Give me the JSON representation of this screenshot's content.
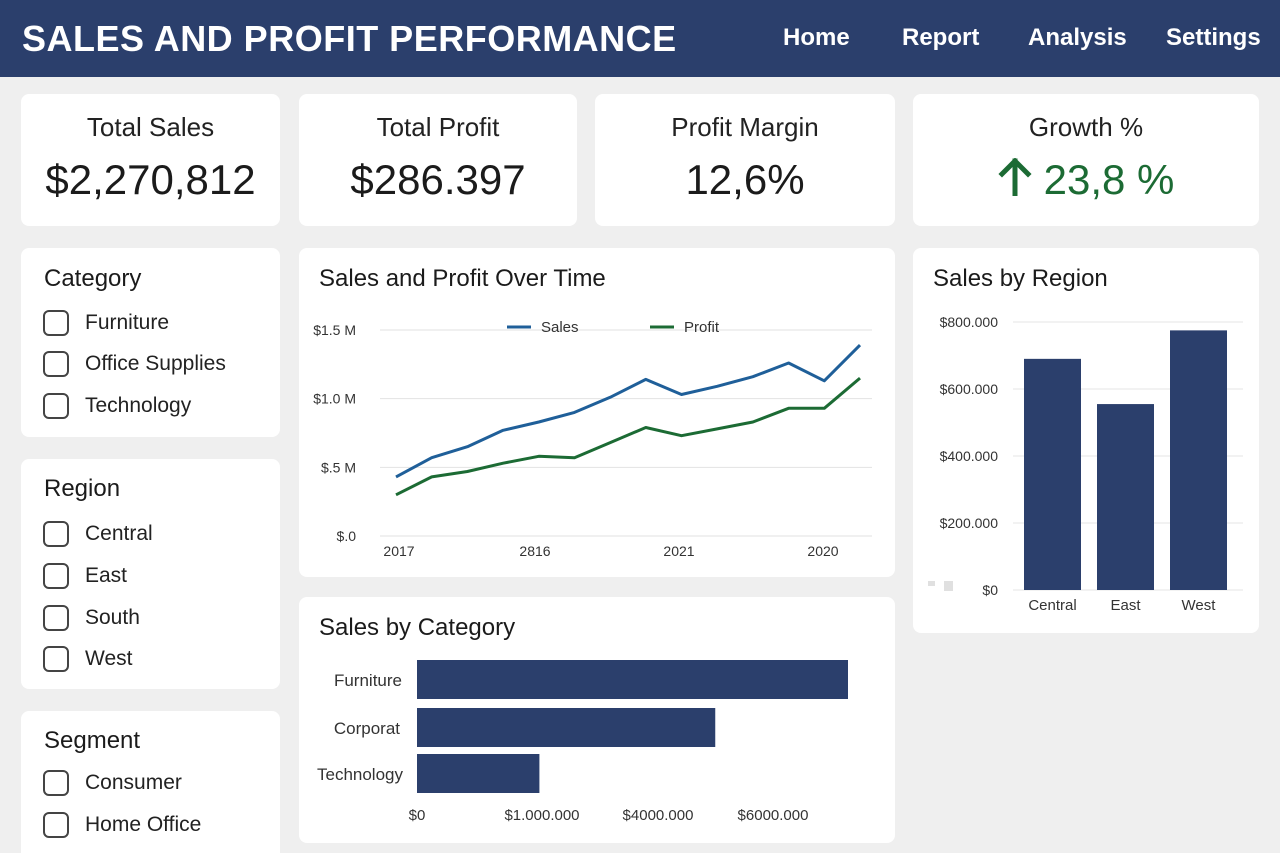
{
  "header": {
    "title": "SALES AND PROFIT PERFORMANCE",
    "nav": [
      "Home",
      "Report",
      "Analysis",
      "Settings"
    ],
    "bg_color": "#2b3f6c"
  },
  "kpis": [
    {
      "label": "Total Sales",
      "value": "$2,270,812"
    },
    {
      "label": "Total Profit",
      "value": "$286.397"
    },
    {
      "label": "Profit Margin",
      "value": "12,6%"
    },
    {
      "label": "Growth %",
      "value": "23,8 %",
      "icon": "arrow-up-icon",
      "color": "#1c6b34"
    }
  ],
  "filters": {
    "category": {
      "title": "Category",
      "items": [
        "Furniture",
        "Office Supplies",
        "Technology"
      ]
    },
    "region": {
      "title": "Region",
      "items": [
        "Central",
        "East",
        "South",
        "West"
      ]
    },
    "segment": {
      "title": "Segment",
      "items": [
        "Consumer",
        "Home Office"
      ]
    }
  },
  "colors": {
    "bar": "#2b3f6c",
    "sales": "#1f5f99",
    "profit": "#1c6b34"
  },
  "chart_data": [
    {
      "type": "line",
      "title": "Sales and Profit Over Time",
      "x_ticks": [
        "2017",
        "2816",
        "2021",
        "2020"
      ],
      "y_ticks": [
        "$.0",
        "$.5 M",
        "$1.0 M",
        "$1.5 M"
      ],
      "ylim": [
        0,
        1.5
      ],
      "legend_position": "top",
      "grid": true,
      "series": [
        {
          "name": "Sales",
          "color": "#1f5f99",
          "values": [
            0.43,
            0.57,
            0.65,
            0.77,
            0.83,
            0.9,
            1.01,
            1.14,
            1.03,
            1.09,
            1.16,
            1.26,
            1.13,
            1.39
          ]
        },
        {
          "name": "Profit",
          "color": "#1c6b34",
          "values": [
            0.3,
            0.43,
            0.47,
            0.53,
            0.58,
            0.57,
            0.68,
            0.79,
            0.73,
            0.78,
            0.83,
            0.93,
            0.93,
            1.15
          ]
        }
      ]
    },
    {
      "type": "bar",
      "orientation": "vertical",
      "title": "Sales by Region",
      "categories": [
        "Central",
        "East",
        "West"
      ],
      "values": [
        690000,
        555000,
        775000
      ],
      "y_ticks": [
        "$0",
        "$200.000",
        "$400.000",
        "$600.000",
        "$800.000"
      ],
      "ylim": [
        0,
        800000
      ],
      "grid": true
    },
    {
      "type": "bar",
      "orientation": "horizontal",
      "title": "Sales by Category",
      "categories": [
        "Furniture",
        "Corporat",
        "Technology"
      ],
      "values": [
        100,
        69.2,
        28.4
      ],
      "x_ticks": [
        "$0",
        "$1.000.000",
        "$4000.000",
        "$6000.000"
      ]
    }
  ]
}
